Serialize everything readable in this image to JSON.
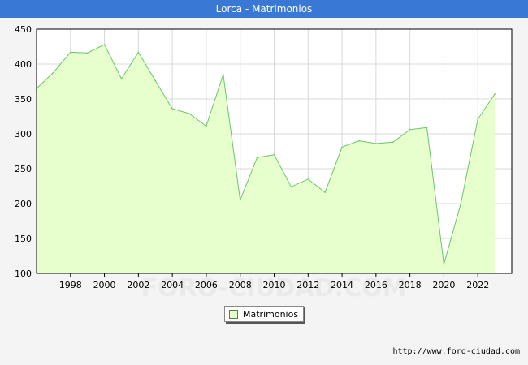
{
  "title": "Lorca - Matrimonios",
  "watermark": "FORO-CIUDAD.COM",
  "source_url": "http://www.foro-ciudad.com",
  "colors": {
    "title_bar": "#3a78d6",
    "area_fill": "#e6ffcc",
    "line": "#6cc46c",
    "grid": "#d8d8d8",
    "background": "#f4f4f4"
  },
  "chart_data": {
    "type": "area",
    "title": "Lorca - Matrimonios",
    "xlabel": "",
    "ylabel": "",
    "xlim": [
      1996,
      2024
    ],
    "ylim": [
      100,
      450
    ],
    "grid": true,
    "legend_position": "bottom-center",
    "x_ticks": [
      1998,
      2000,
      2002,
      2004,
      2006,
      2008,
      2010,
      2012,
      2014,
      2016,
      2018,
      2020,
      2022
    ],
    "y_ticks": [
      100,
      150,
      200,
      250,
      300,
      350,
      400,
      450
    ],
    "x": [
      1996,
      1997,
      1998,
      1999,
      2000,
      2001,
      2002,
      2003,
      2004,
      2005,
      2006,
      2007,
      2008,
      2009,
      2010,
      2011,
      2012,
      2013,
      2014,
      2015,
      2016,
      2017,
      2018,
      2019,
      2020,
      2021,
      2022,
      2023
    ],
    "series": [
      {
        "name": "Matrimonios",
        "values": [
          365,
          388,
          417,
          416,
          428,
          379,
          417,
          376,
          336,
          329,
          311,
          385,
          205,
          266,
          270,
          224,
          235,
          216,
          281,
          290,
          286,
          288,
          306,
          309,
          113,
          200,
          321,
          357
        ]
      }
    ]
  }
}
